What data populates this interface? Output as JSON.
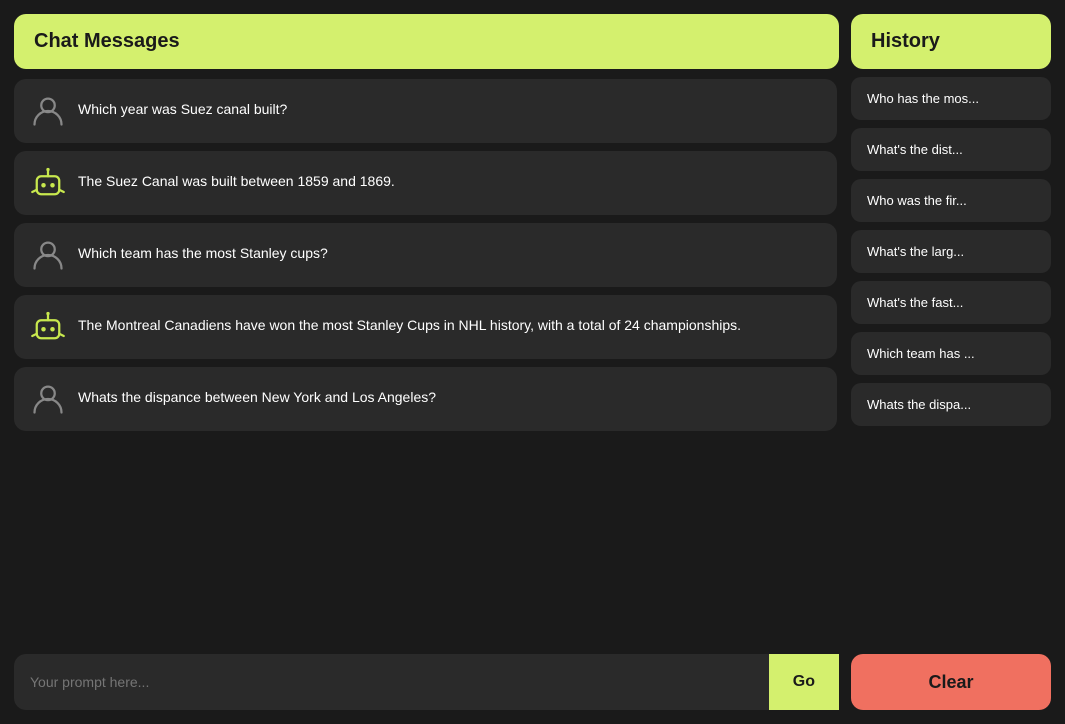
{
  "chat": {
    "header_title": "Chat Messages",
    "messages": [
      {
        "type": "user",
        "text": "Which year was Suez canal built?"
      },
      {
        "type": "bot",
        "text": "The Suez Canal was built between 1859 and 1869."
      },
      {
        "type": "user",
        "text": "Which team has the most Stanley cups?"
      },
      {
        "type": "bot",
        "text": "The Montreal Canadiens have won the most Stanley Cups in NHL history, with a total of 24 championships."
      },
      {
        "type": "user",
        "text": "Whats the dispance between New York and Los Angeles?"
      }
    ],
    "input_placeholder": "Your prompt here...",
    "go_button_label": "Go"
  },
  "history": {
    "header_title": "History",
    "items": [
      "Who has the mos...",
      "What's the dist...",
      "Who was the fir...",
      "What's the larg...",
      "What's the fast...",
      "Which team has ...",
      "Whats the dispa..."
    ],
    "clear_button_label": "Clear"
  },
  "icons": {
    "user_color": "#888888",
    "bot_color": "#c8e84e"
  }
}
